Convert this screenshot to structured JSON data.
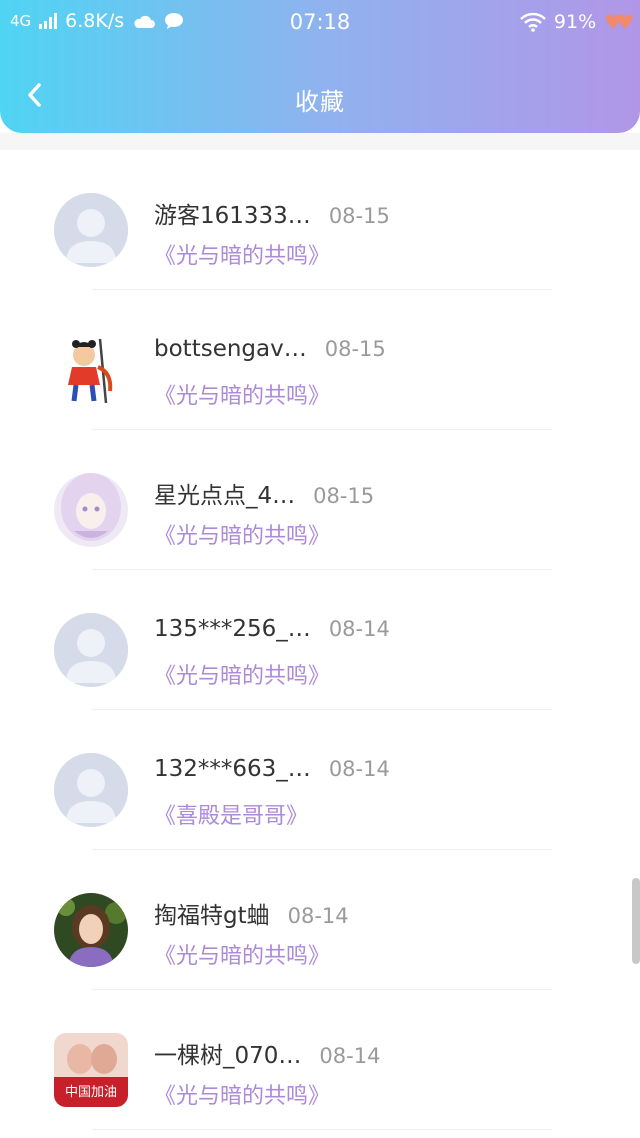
{
  "status_bar": {
    "network": "4G",
    "speed": "6.8K/s",
    "time": "07:18",
    "battery": "91%",
    "icons": [
      "signal-icon",
      "cloud-icon",
      "chat-bubble-icon",
      "wifi-icon",
      "hearts-icon"
    ]
  },
  "header": {
    "title": "收藏",
    "back_icon": "chevron-left-icon"
  },
  "favorites": [
    {
      "name": "游客161333…",
      "date": "08-15",
      "work": "《光与暗的共鸣》",
      "avatar": "default"
    },
    {
      "name": "bottsengav…",
      "date": "08-15",
      "work": "《光与暗的共鸣》",
      "avatar": "cartoon-warrior"
    },
    {
      "name": "星光点点_4…",
      "date": "08-15",
      "work": "《光与暗的共鸣》",
      "avatar": "anime-girl"
    },
    {
      "name": "135***256_…",
      "date": "08-14",
      "work": "《光与暗的共鸣》",
      "avatar": "default"
    },
    {
      "name": "132***663_…",
      "date": "08-14",
      "work": "《喜殿是哥哥》",
      "avatar": "default"
    },
    {
      "name": "掏福特gt蛐",
      "date": "08-14",
      "work": "《光与暗的共鸣》",
      "avatar": "photo-woman"
    },
    {
      "name": "一棵树_070…",
      "date": "08-14",
      "work": "《光与暗的共鸣》",
      "avatar": "photo-logo"
    }
  ],
  "avatar_logo_text": "中国加油",
  "colors": {
    "header_gradient_start": "#4fd4f3",
    "header_gradient_end": "#b196e8",
    "work_title": "#ad8ad8",
    "date": "#9a9a9a",
    "name": "#333333"
  }
}
